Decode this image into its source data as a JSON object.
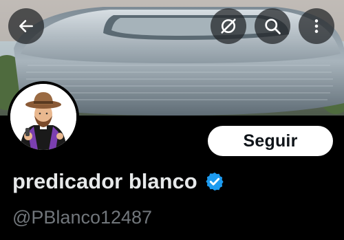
{
  "header": {
    "banner_description_icon": "stadium-banner",
    "back_icon": "arrow-left-icon",
    "grok_icon": "grok-icon",
    "search_icon": "search-icon",
    "more_icon": "more-vertical-icon"
  },
  "profile": {
    "display_name": "predicador blanco",
    "handle": "@PBlanco12487",
    "verified": true,
    "follow_label": "Seguir"
  },
  "colors": {
    "background": "#000000",
    "name": "#e7e9ea",
    "handle": "#71767b",
    "verified_badge": "#1d9bf0",
    "follow_bg": "#ffffff",
    "follow_text": "#0f1419"
  }
}
